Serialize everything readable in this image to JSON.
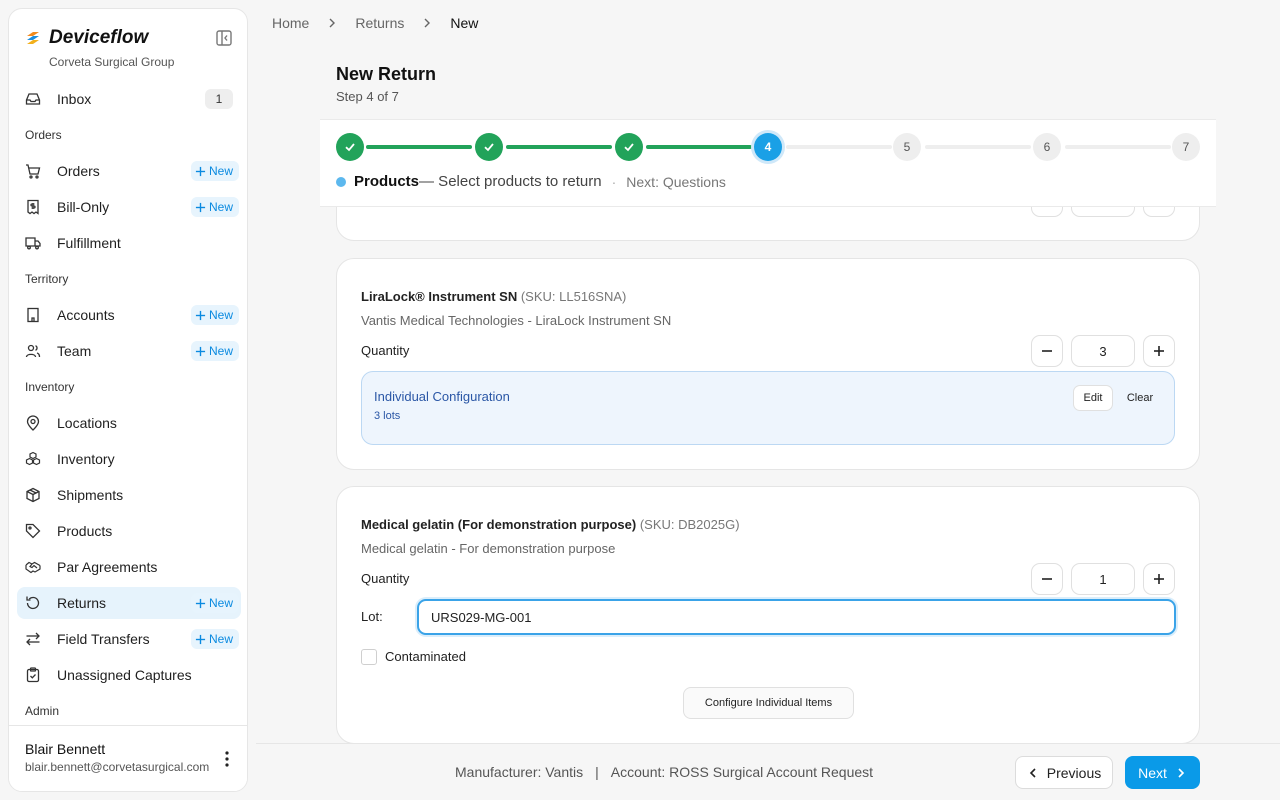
{
  "app": {
    "name": "Deviceflow",
    "org": "Corveta Surgical Group"
  },
  "sidebar": {
    "items": [
      {
        "label": "Inbox",
        "badge": "1"
      },
      {
        "section": "Orders"
      },
      {
        "label": "Orders",
        "new": "New"
      },
      {
        "label": "Bill-Only",
        "new": "New"
      },
      {
        "label": "Fulfillment"
      },
      {
        "section": "Territory"
      },
      {
        "label": "Accounts",
        "new": "New"
      },
      {
        "label": "Team",
        "new": "New"
      },
      {
        "section": "Inventory"
      },
      {
        "label": "Locations"
      },
      {
        "label": "Inventory"
      },
      {
        "label": "Shipments"
      },
      {
        "label": "Products"
      },
      {
        "label": "Par Agreements"
      },
      {
        "label": "Returns",
        "new": "New"
      },
      {
        "label": "Field Transfers",
        "new": "New"
      },
      {
        "label": "Unassigned Captures"
      },
      {
        "section": "Admin"
      }
    ],
    "user": {
      "name": "Blair Bennett",
      "email": "blair.bennett@corvetasurgical.com"
    }
  },
  "breadcrumb": [
    "Home",
    "Returns",
    "New"
  ],
  "header": {
    "title": "New Return",
    "step": "Step 4 of 7"
  },
  "stepper": {
    "steps": [
      {
        "label": "1",
        "state": "done"
      },
      {
        "label": "2",
        "state": "done"
      },
      {
        "label": "3",
        "state": "done"
      },
      {
        "label": "4",
        "state": "current"
      },
      {
        "label": "5",
        "state": "todo"
      },
      {
        "label": "6",
        "state": "todo"
      },
      {
        "label": "7",
        "state": "todo"
      }
    ],
    "current_name": "Products",
    "current_desc": "— Select products to return",
    "dot": "·",
    "next": "Next: Questions"
  },
  "products": [
    {
      "name": "LiraLock® Instrument SN",
      "sku": "(SKU: LL516SNA)",
      "description": "Vantis Medical Technologies - LiraLock Instrument SN",
      "quantity_label": "Quantity",
      "quantity": "3",
      "config": {
        "title": "Individual Configuration",
        "summary": "3 lots",
        "edit": "Edit",
        "clear": "Clear"
      }
    },
    {
      "name": "Medical gelatin (For demonstration purpose)",
      "sku": "(SKU: DB2025G)",
      "description": "Medical gelatin - For demonstration purpose",
      "quantity_label": "Quantity",
      "quantity": "1",
      "lot_label": "Lot:",
      "lot_value": "URS029-MG-001",
      "contaminated_label": "Contaminated",
      "configure_button": "Configure Individual Items"
    }
  ],
  "footer": {
    "manufacturer": "Manufacturer: Vantis",
    "separator": "|",
    "account": "Account: ROSS Surgical Account Request",
    "previous": "Previous",
    "next": "Next"
  },
  "colors": {
    "accent": "#0a9ae8",
    "done": "#22a35a",
    "new_pill_text": "#0a8ae0"
  }
}
